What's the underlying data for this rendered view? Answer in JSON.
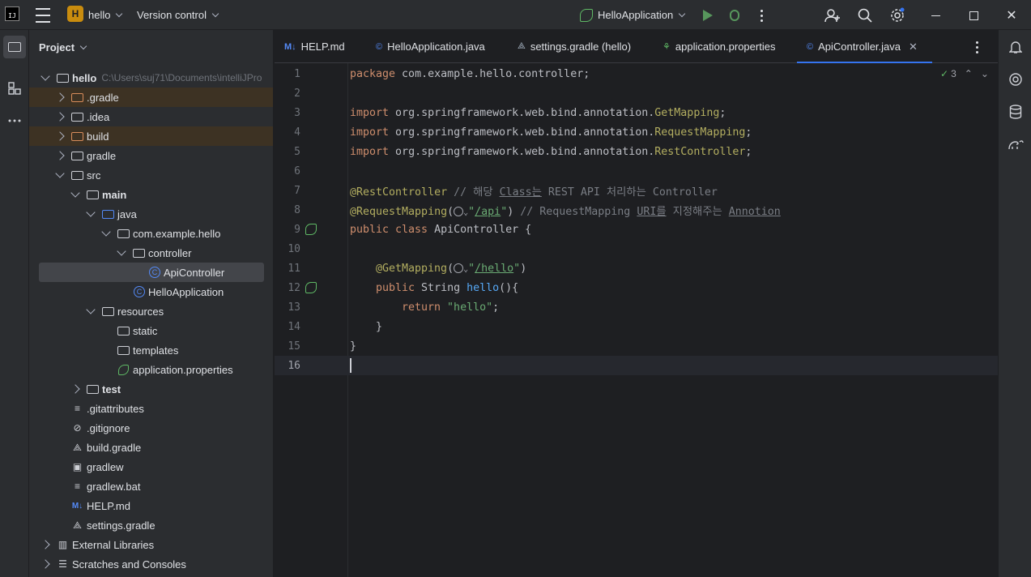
{
  "titlebar": {
    "app_logo": "IJ",
    "project_badge": "H",
    "project_name": "hello",
    "vcs_label": "Version control",
    "run_config": "HelloApplication",
    "close_glyph": "✕"
  },
  "project_panel": {
    "title": "Project",
    "root": {
      "name": "hello",
      "path": "C:\\Users\\suj71\\Documents\\intelliJPro"
    },
    "items": [
      {
        "label": ".gradle"
      },
      {
        "label": ".idea"
      },
      {
        "label": "build"
      },
      {
        "label": "gradle"
      },
      {
        "label": "src"
      },
      {
        "label": "main"
      },
      {
        "label": "java"
      },
      {
        "label": "com.example.hello"
      },
      {
        "label": "controller"
      },
      {
        "label": "ApiController"
      },
      {
        "label": "HelloApplication"
      },
      {
        "label": "resources"
      },
      {
        "label": "static"
      },
      {
        "label": "templates"
      },
      {
        "label": "application.properties"
      },
      {
        "label": "test"
      },
      {
        "label": ".gitattributes"
      },
      {
        "label": ".gitignore"
      },
      {
        "label": "build.gradle"
      },
      {
        "label": "gradlew"
      },
      {
        "label": "gradlew.bat"
      },
      {
        "label": "HELP.md"
      },
      {
        "label": "settings.gradle"
      },
      {
        "label": "External Libraries"
      },
      {
        "label": "Scratches and Consoles"
      }
    ]
  },
  "tabs": [
    {
      "icon": "M↓",
      "label": "HELP.md"
    },
    {
      "icon": "©",
      "label": "HelloApplication.java"
    },
    {
      "icon": "⟁",
      "label": "settings.gradle (hello)"
    },
    {
      "icon": "⚘",
      "label": "application.properties"
    },
    {
      "icon": "©",
      "label": "ApiController.java",
      "close": "✕"
    }
  ],
  "editor": {
    "inspections_count": "3",
    "line_numbers": [
      "1",
      "2",
      "3",
      "4",
      "5",
      "6",
      "7",
      "8",
      "9",
      "10",
      "11",
      "12",
      "13",
      "14",
      "15",
      "16"
    ],
    "code": {
      "l1_kw": "package",
      "l1_rest": " com.example.hello.controller;",
      "l3_kw": "import",
      "l3_pkg": " org.springframework.web.bind.annotation.",
      "l3_cls": "GetMapping",
      "l3_end": ";",
      "l4_kw": "import",
      "l4_pkg": " org.springframework.web.bind.annotation.",
      "l4_cls": "RequestMapping",
      "l4_end": ";",
      "l5_kw": "import",
      "l5_pkg": " org.springframework.web.bind.annotation.",
      "l5_cls": "RestController",
      "l5_end": ";",
      "l7_ann": "@RestController",
      "l7_cm1": " // 해당 ",
      "l7_cm2": "Class는",
      "l7_cm3": " REST API 처리하는 Controller",
      "l8_ann": "@RequestMapping",
      "l8_open": "(",
      "l8_str1": "\"",
      "l8_str2": "/api",
      "l8_str3": "\"",
      "l8_close": ")",
      "l8_cm1": " // RequestMapping ",
      "l8_cm2": "URI를",
      "l8_cm3": " 지정해주는 ",
      "l8_cm4": "Annotion",
      "l9_kw": "public class",
      "l9_rest": " ApiController {",
      "l11_ann": "@GetMapping",
      "l11_open": "(",
      "l11_str1": "\"",
      "l11_str2": "/hello",
      "l11_str3": "\"",
      "l11_close": ")",
      "l12_kw": "public",
      "l12_type": " String ",
      "l12_fn": "hello",
      "l12_rest": "(){",
      "l13_kw": "return",
      "l13_str": " \"hello\"",
      "l13_end": ";",
      "l14": "}",
      "l15": "}"
    }
  },
  "colors": {
    "accent": "#3574f0",
    "keyword": "#cf8e6d",
    "annotation": "#b3ae60",
    "string": "#6aab73",
    "comment": "#7a7e85",
    "function": "#56a8f5"
  }
}
